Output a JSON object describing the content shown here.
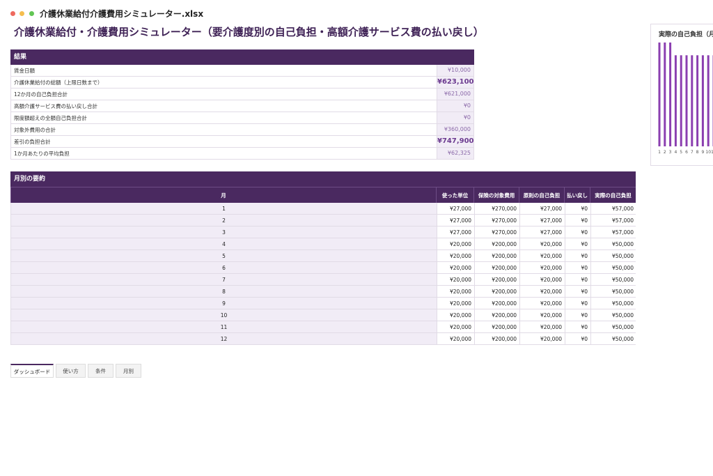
{
  "window": {
    "filename": "介護休業給付介護費用シミュレーター.xlsx"
  },
  "page": {
    "title": "介護休業給付・介護費用シミュレーター（要介護度別の自己負担・高額介護サービス費の払い戻し）"
  },
  "results": {
    "header": "結果",
    "rows": [
      {
        "label": "賃金日額",
        "value": "¥10,000",
        "strong": false
      },
      {
        "label": "介護休業給付の総額（上限日数まで）",
        "value": "¥623,100",
        "strong": true
      },
      {
        "label": "12か月の自己負担合計",
        "value": "¥621,000",
        "strong": false
      },
      {
        "label": "高額介護サービス費の払い戻し合計",
        "value": "¥0",
        "strong": false
      },
      {
        "label": "限度額超えの全額自己負担合計",
        "value": "¥0",
        "strong": false
      },
      {
        "label": "対象外費用の合計",
        "value": "¥360,000",
        "strong": false
      },
      {
        "label": "差引の負担合計",
        "value": "¥747,900",
        "strong": true
      },
      {
        "label": "1か月あたりの平均負担",
        "value": "¥62,325",
        "strong": false
      }
    ]
  },
  "monthly": {
    "header": "月別の要約",
    "columns": [
      "月",
      "使った単位",
      "保険の対象費用",
      "原則の自己負担",
      "払い戻し",
      "実際の自己負担"
    ],
    "rows": [
      [
        "1",
        "¥27,000",
        "¥270,000",
        "¥27,000",
        "¥0",
        "¥57,000"
      ],
      [
        "2",
        "¥27,000",
        "¥270,000",
        "¥27,000",
        "¥0",
        "¥57,000"
      ],
      [
        "3",
        "¥27,000",
        "¥270,000",
        "¥27,000",
        "¥0",
        "¥57,000"
      ],
      [
        "4",
        "¥20,000",
        "¥200,000",
        "¥20,000",
        "¥0",
        "¥50,000"
      ],
      [
        "5",
        "¥20,000",
        "¥200,000",
        "¥20,000",
        "¥0",
        "¥50,000"
      ],
      [
        "6",
        "¥20,000",
        "¥200,000",
        "¥20,000",
        "¥0",
        "¥50,000"
      ],
      [
        "7",
        "¥20,000",
        "¥200,000",
        "¥20,000",
        "¥0",
        "¥50,000"
      ],
      [
        "8",
        "¥20,000",
        "¥200,000",
        "¥20,000",
        "¥0",
        "¥50,000"
      ],
      [
        "9",
        "¥20,000",
        "¥200,000",
        "¥20,000",
        "¥0",
        "¥50,000"
      ],
      [
        "10",
        "¥20,000",
        "¥200,000",
        "¥20,000",
        "¥0",
        "¥50,000"
      ],
      [
        "11",
        "¥20,000",
        "¥200,000",
        "¥20,000",
        "¥0",
        "¥50,000"
      ],
      [
        "12",
        "¥20,000",
        "¥200,000",
        "¥20,000",
        "¥0",
        "¥50,000"
      ]
    ]
  },
  "chart": {
    "title": "実際の自己負担（月",
    "bar_color": "#8b3fb0"
  },
  "chart_data": {
    "type": "bar",
    "title": "実際の自己負担（月",
    "categories": [
      "1",
      "2",
      "3",
      "4",
      "5",
      "6",
      "7",
      "8",
      "9",
      "10",
      "11",
      "12"
    ],
    "values": [
      57000,
      57000,
      57000,
      50000,
      50000,
      50000,
      50000,
      50000,
      50000,
      50000,
      50000,
      50000
    ],
    "ylim": [
      0,
      57000
    ],
    "grid": false
  },
  "sheet_tabs": [
    {
      "label": "ダッシュボード",
      "active": true
    },
    {
      "label": "使い方",
      "active": false
    },
    {
      "label": "条件",
      "active": false
    },
    {
      "label": "月別",
      "active": false
    }
  ]
}
